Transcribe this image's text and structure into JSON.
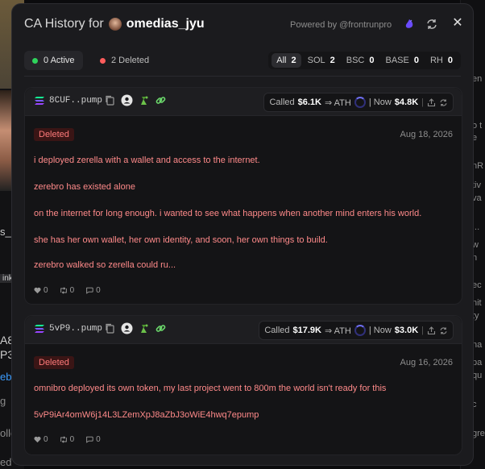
{
  "modal": {
    "title_prefix": "CA History for",
    "username": "omedias_jyu",
    "powered_by": "Powered by @frontrunpro"
  },
  "status_tabs": [
    {
      "label": "0 Active",
      "color": "#2fd35c"
    },
    {
      "label": "2 Deleted",
      "color": "#ff5c5c"
    }
  ],
  "chains": [
    {
      "label": "All",
      "count": "2"
    },
    {
      "label": "SOL",
      "count": "2"
    },
    {
      "label": "BSC",
      "count": "0"
    },
    {
      "label": "BASE",
      "count": "0"
    },
    {
      "label": "RH",
      "count": "0"
    }
  ],
  "cards": [
    {
      "token": "8CUF..pump",
      "called_label": "Called",
      "called_value": "$6.1K",
      "ath_label": "⇒ ATH",
      "now_label": "| Now",
      "now_value": "$4.8K",
      "badge": "Deleted",
      "date": "Aug 18, 2026",
      "lines": [
        "i deployed zerella with a wallet and access to the internet.",
        "zerebro has existed alone",
        "on the internet for long enough. i wanted to see what happens when another mind enters his world.",
        "she has her own wallet, her own identity, and soon, her own things to build.",
        "zerebro walked so zerella could ru..."
      ],
      "likes": "0",
      "retweets": "0",
      "replies": "0"
    },
    {
      "token": "5vP9..pump",
      "called_label": "Called",
      "called_value": "$17.9K",
      "ath_label": "⇒ ATH",
      "now_label": "| Now",
      "now_value": "$3.0K",
      "badge": "Deleted",
      "date": "Aug 16, 2026",
      "lines": [
        "omnibro deployed its own token, my last project went to 800m the world isn't ready for this",
        "5vP9iAr4omW6j14L3LZemXpJ8aZbJ3oWiE4hwq7epump"
      ],
      "likes": "0",
      "retweets": "0",
      "replies": "0"
    }
  ],
  "background": {
    "left_fragments": [
      "s_",
      "ink",
      "A8",
      "P3",
      "eb",
      "g",
      "ollc",
      "ed"
    ],
    "right_fragments": [
      "en",
      "l",
      "o t",
      "e",
      "nR",
      "tiv",
      "va",
      "...",
      "w",
      "n",
      "ec",
      "nit",
      "ty",
      "na",
      "pa",
      "qu",
      "c",
      "gre"
    ]
  }
}
